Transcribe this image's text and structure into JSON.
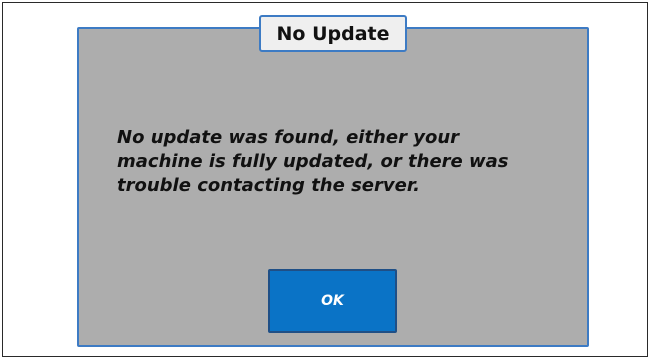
{
  "dialog": {
    "title": "No Update",
    "message_lines": [
      "No update was found, either your",
      "machine is fully updated, or there was",
      "trouble contacting the server."
    ],
    "ok_label": "OK"
  },
  "colors": {
    "dialog_bg": "#adadad",
    "border_accent": "#3d7bc4",
    "button_bg": "#0a73c6",
    "title_bg": "#efefef"
  }
}
